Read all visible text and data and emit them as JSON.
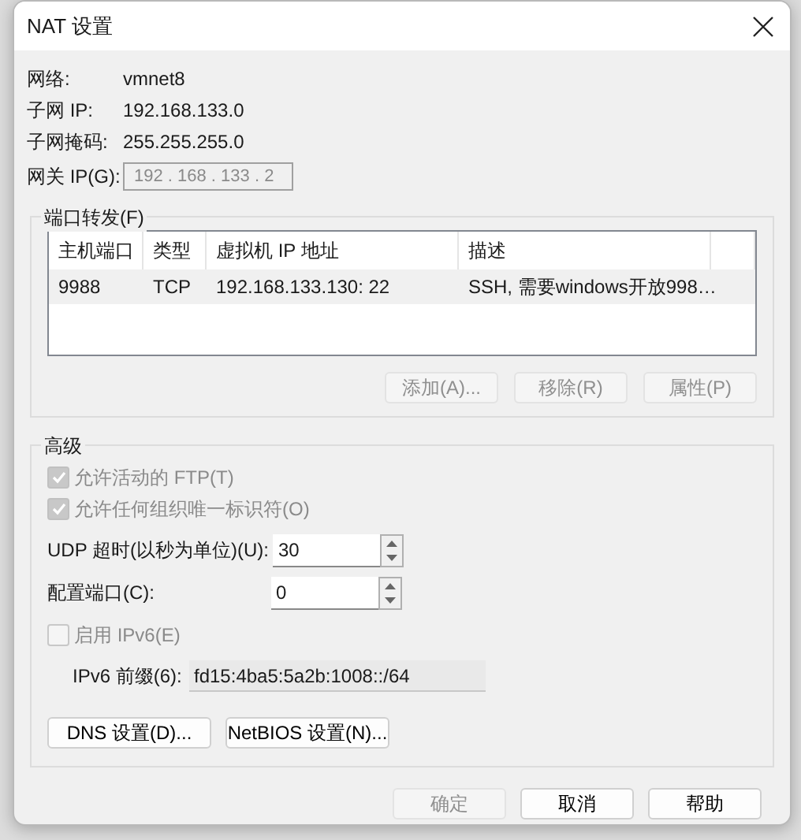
{
  "window": {
    "title": "NAT 设置"
  },
  "info": [
    {
      "label": "网络:",
      "value": "vmnet8"
    },
    {
      "label": "子网 IP:",
      "value": "192.168.133.0"
    },
    {
      "label": "子网掩码:",
      "value": "255.255.255.0"
    }
  ],
  "gateway": {
    "label": "网关 IP(G):",
    "value": "192 . 168 . 133 . 2",
    "disabled": true
  },
  "port_forwarding": {
    "title": "端口转发(F)",
    "columns": [
      "主机端口",
      "类型",
      "虚拟机 IP 地址",
      "描述"
    ],
    "rows": [
      {
        "cells": [
          "9988",
          "TCP",
          "192.168.133.130: 22",
          "SSH, 需要windows开放998…"
        ],
        "selected": false
      }
    ],
    "buttons": [
      {
        "label": "添加(A)...",
        "disabled": true
      },
      {
        "label": "移除(R)",
        "disabled": true
      },
      {
        "label": "属性(P)",
        "disabled": true
      }
    ]
  },
  "advanced": {
    "title": "高级",
    "checkboxes": [
      {
        "label": "允许活动的 FTP(T)",
        "checked": true,
        "disabled": true
      },
      {
        "label": "允许任何组织唯一标识符(O)",
        "checked": true,
        "disabled": true
      }
    ],
    "spinners": [
      {
        "label": "UDP 超时(以秒为单位)(U):",
        "value": "30"
      },
      {
        "label": "配置端口(C):",
        "value": "0"
      }
    ],
    "ipv6": {
      "label": "启用 IPv6(E)",
      "checked": false,
      "disabled": true
    },
    "prefix": {
      "label": "IPv6 前缀(6):",
      "value": "fd15:4ba5:5a2b:1008::/64"
    },
    "buttons": [
      {
        "label": "DNS 设置(D)..."
      },
      {
        "label": "NetBIOS 设置(N)..."
      }
    ]
  },
  "footer": [
    {
      "label": "确定",
      "disabled": true
    },
    {
      "label": "取消",
      "disabled": false
    },
    {
      "label": "帮助",
      "disabled": false
    }
  ]
}
